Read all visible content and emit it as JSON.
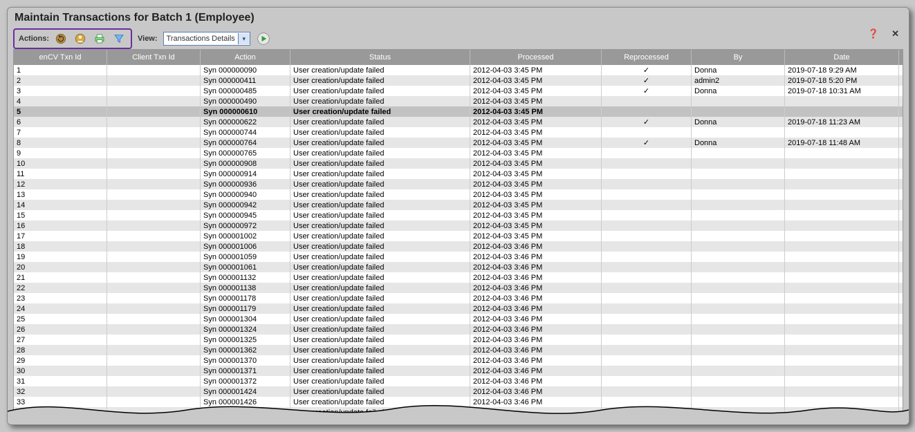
{
  "title": "Maintain Transactions for Batch 1 (Employee)",
  "toolbar": {
    "actions_label": "Actions:",
    "view_label": "View:",
    "view_value": "Transactions Details"
  },
  "columns": {
    "id": "enCV Txn Id",
    "client": "Client Txn Id",
    "action": "Action",
    "status": "Status",
    "processed": "Processed",
    "reprocessed": "Reprocessed",
    "by": "By",
    "date": "Date"
  },
  "selected_row_index": 4,
  "rows": [
    {
      "id": "1",
      "client": "",
      "action": "Syn 000000090",
      "status": "User creation/update failed",
      "processed": "2012-04-03 3:45 PM",
      "reprocessed": "✓",
      "by": "Donna",
      "date": "2019-07-18 9:29 AM"
    },
    {
      "id": "2",
      "client": "",
      "action": "Syn 000000411",
      "status": "User creation/update failed",
      "processed": "2012-04-03 3:45 PM",
      "reprocessed": "✓",
      "by": "admin2",
      "date": "2019-07-18 5:20 PM"
    },
    {
      "id": "3",
      "client": "",
      "action": "Syn 000000485",
      "status": "User creation/update failed",
      "processed": "2012-04-03 3:45 PM",
      "reprocessed": "✓",
      "by": "Donna",
      "date": "2019-07-18 10:31 AM"
    },
    {
      "id": "4",
      "client": "",
      "action": "Syn 000000490",
      "status": "User creation/update failed",
      "processed": "2012-04-03 3:45 PM",
      "reprocessed": "",
      "by": "",
      "date": ""
    },
    {
      "id": "5",
      "client": "",
      "action": "Syn 000000610",
      "status": "User creation/update failed",
      "processed": "2012-04-03 3:45 PM",
      "reprocessed": "",
      "by": "",
      "date": ""
    },
    {
      "id": "6",
      "client": "",
      "action": "Syn 000000622",
      "status": "User creation/update failed",
      "processed": "2012-04-03 3:45 PM",
      "reprocessed": "✓",
      "by": "Donna",
      "date": "2019-07-18 11:23 AM"
    },
    {
      "id": "7",
      "client": "",
      "action": "Syn 000000744",
      "status": "User creation/update failed",
      "processed": "2012-04-03 3:45 PM",
      "reprocessed": "",
      "by": "",
      "date": ""
    },
    {
      "id": "8",
      "client": "",
      "action": "Syn 000000764",
      "status": "User creation/update failed",
      "processed": "2012-04-03 3:45 PM",
      "reprocessed": "✓",
      "by": "Donna",
      "date": "2019-07-18 11:48 AM"
    },
    {
      "id": "9",
      "client": "",
      "action": "Syn 000000765",
      "status": "User creation/update failed",
      "processed": "2012-04-03 3:45 PM",
      "reprocessed": "",
      "by": "",
      "date": ""
    },
    {
      "id": "10",
      "client": "",
      "action": "Syn 000000908",
      "status": "User creation/update failed",
      "processed": "2012-04-03 3:45 PM",
      "reprocessed": "",
      "by": "",
      "date": ""
    },
    {
      "id": "11",
      "client": "",
      "action": "Syn 000000914",
      "status": "User creation/update failed",
      "processed": "2012-04-03 3:45 PM",
      "reprocessed": "",
      "by": "",
      "date": ""
    },
    {
      "id": "12",
      "client": "",
      "action": "Syn 000000936",
      "status": "User creation/update failed",
      "processed": "2012-04-03 3:45 PM",
      "reprocessed": "",
      "by": "",
      "date": ""
    },
    {
      "id": "13",
      "client": "",
      "action": "Syn 000000940",
      "status": "User creation/update failed",
      "processed": "2012-04-03 3:45 PM",
      "reprocessed": "",
      "by": "",
      "date": ""
    },
    {
      "id": "14",
      "client": "",
      "action": "Syn 000000942",
      "status": "User creation/update failed",
      "processed": "2012-04-03 3:45 PM",
      "reprocessed": "",
      "by": "",
      "date": ""
    },
    {
      "id": "15",
      "client": "",
      "action": "Syn 000000945",
      "status": "User creation/update failed",
      "processed": "2012-04-03 3:45 PM",
      "reprocessed": "",
      "by": "",
      "date": ""
    },
    {
      "id": "16",
      "client": "",
      "action": "Syn 000000972",
      "status": "User creation/update failed",
      "processed": "2012-04-03 3:45 PM",
      "reprocessed": "",
      "by": "",
      "date": ""
    },
    {
      "id": "17",
      "client": "",
      "action": "Syn 000001002",
      "status": "User creation/update failed",
      "processed": "2012-04-03 3:45 PM",
      "reprocessed": "",
      "by": "",
      "date": ""
    },
    {
      "id": "18",
      "client": "",
      "action": "Syn 000001006",
      "status": "User creation/update failed",
      "processed": "2012-04-03 3:46 PM",
      "reprocessed": "",
      "by": "",
      "date": ""
    },
    {
      "id": "19",
      "client": "",
      "action": "Syn 000001059",
      "status": "User creation/update failed",
      "processed": "2012-04-03 3:46 PM",
      "reprocessed": "",
      "by": "",
      "date": ""
    },
    {
      "id": "20",
      "client": "",
      "action": "Syn 000001061",
      "status": "User creation/update failed",
      "processed": "2012-04-03 3:46 PM",
      "reprocessed": "",
      "by": "",
      "date": ""
    },
    {
      "id": "21",
      "client": "",
      "action": "Syn 000001132",
      "status": "User creation/update failed",
      "processed": "2012-04-03 3:46 PM",
      "reprocessed": "",
      "by": "",
      "date": ""
    },
    {
      "id": "22",
      "client": "",
      "action": "Syn 000001138",
      "status": "User creation/update failed",
      "processed": "2012-04-03 3:46 PM",
      "reprocessed": "",
      "by": "",
      "date": ""
    },
    {
      "id": "23",
      "client": "",
      "action": "Syn 000001178",
      "status": "User creation/update failed",
      "processed": "2012-04-03 3:46 PM",
      "reprocessed": "",
      "by": "",
      "date": ""
    },
    {
      "id": "24",
      "client": "",
      "action": "Syn 000001179",
      "status": "User creation/update failed",
      "processed": "2012-04-03 3:46 PM",
      "reprocessed": "",
      "by": "",
      "date": ""
    },
    {
      "id": "25",
      "client": "",
      "action": "Syn 000001304",
      "status": "User creation/update failed",
      "processed": "2012-04-03 3:46 PM",
      "reprocessed": "",
      "by": "",
      "date": ""
    },
    {
      "id": "26",
      "client": "",
      "action": "Syn 000001324",
      "status": "User creation/update failed",
      "processed": "2012-04-03 3:46 PM",
      "reprocessed": "",
      "by": "",
      "date": ""
    },
    {
      "id": "27",
      "client": "",
      "action": "Syn 000001325",
      "status": "User creation/update failed",
      "processed": "2012-04-03 3:46 PM",
      "reprocessed": "",
      "by": "",
      "date": ""
    },
    {
      "id": "28",
      "client": "",
      "action": "Syn 000001362",
      "status": "User creation/update failed",
      "processed": "2012-04-03 3:46 PM",
      "reprocessed": "",
      "by": "",
      "date": ""
    },
    {
      "id": "29",
      "client": "",
      "action": "Syn 000001370",
      "status": "User creation/update failed",
      "processed": "2012-04-03 3:46 PM",
      "reprocessed": "",
      "by": "",
      "date": ""
    },
    {
      "id": "30",
      "client": "",
      "action": "Syn 000001371",
      "status": "User creation/update failed",
      "processed": "2012-04-03 3:46 PM",
      "reprocessed": "",
      "by": "",
      "date": ""
    },
    {
      "id": "31",
      "client": "",
      "action": "Syn 000001372",
      "status": "User creation/update failed",
      "processed": "2012-04-03 3:46 PM",
      "reprocessed": "",
      "by": "",
      "date": ""
    },
    {
      "id": "32",
      "client": "",
      "action": "Syn 000001424",
      "status": "User creation/update failed",
      "processed": "2012-04-03 3:46 PM",
      "reprocessed": "",
      "by": "",
      "date": ""
    },
    {
      "id": "33",
      "client": "",
      "action": "Syn 000001426",
      "status": "User creation/update failed",
      "processed": "2012-04-03 3:46 PM",
      "reprocessed": "",
      "by": "",
      "date": ""
    },
    {
      "id": "",
      "client": "",
      "action": "",
      "status": "User creation/update failed",
      "processed": "",
      "reprocessed": "",
      "by": "",
      "date": ""
    }
  ]
}
